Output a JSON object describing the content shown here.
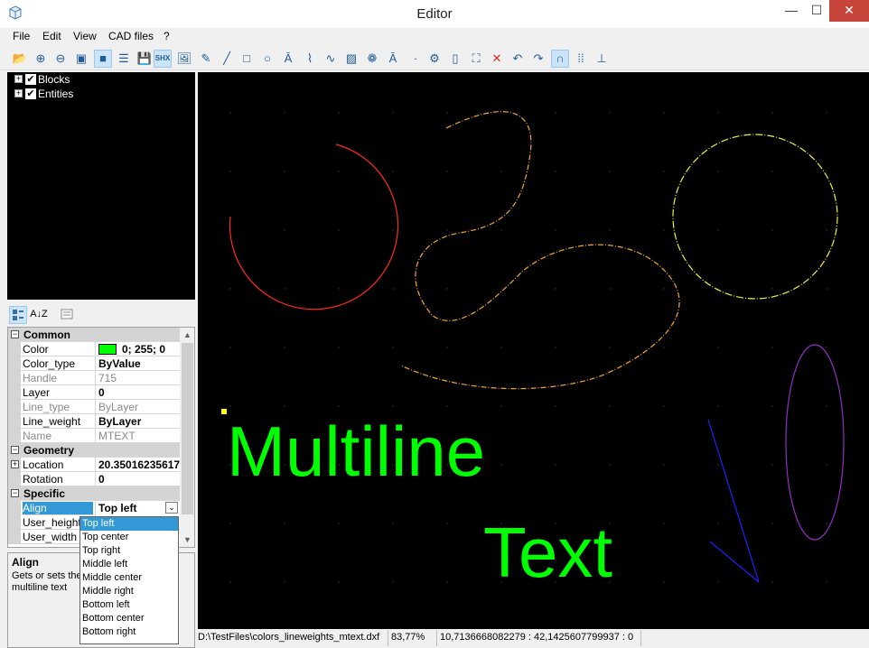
{
  "window": {
    "title": "Editor",
    "minimize": "—",
    "maximize": "☐",
    "close": "✕"
  },
  "menu": [
    {
      "label": "File"
    },
    {
      "label": "Edit"
    },
    {
      "label": "View"
    },
    {
      "label": "CAD files"
    },
    {
      "label": "?"
    }
  ],
  "toolbar": {
    "buttons": [
      {
        "icon": "open-folder-icon",
        "glyph": "📂"
      },
      {
        "icon": "zoom-in-icon",
        "glyph": "⊕"
      },
      {
        "icon": "zoom-out-icon",
        "glyph": "⊖"
      },
      {
        "icon": "zoom-fit-icon",
        "glyph": "▣"
      },
      {
        "icon": "black-background-icon",
        "glyph": "■",
        "active": true
      },
      {
        "icon": "layers-icon",
        "glyph": "☰"
      },
      {
        "icon": "save-icon",
        "glyph": "💾"
      },
      {
        "icon": "shx-fonts-icon",
        "label": "SHX",
        "active": true
      },
      {
        "icon": "image-icon",
        "glyph": "🖼"
      },
      {
        "icon": "pencil-icon",
        "glyph": "✎"
      },
      {
        "icon": "line-icon",
        "glyph": "╱"
      },
      {
        "icon": "rectangle-icon",
        "glyph": "□"
      },
      {
        "icon": "circle-icon",
        "glyph": "○"
      },
      {
        "icon": "text-icon",
        "glyph": "Ā"
      },
      {
        "icon": "polyline-icon",
        "glyph": "⌇"
      },
      {
        "icon": "spline-icon",
        "glyph": "∿"
      },
      {
        "icon": "hatch-icon",
        "glyph": "▨"
      },
      {
        "icon": "block-icon",
        "glyph": "❁"
      },
      {
        "icon": "mtext-icon",
        "glyph": "Ā"
      },
      {
        "icon": "point-icon",
        "glyph": "·"
      },
      {
        "icon": "properties-icon",
        "glyph": "⚙"
      },
      {
        "icon": "new-page-icon",
        "glyph": "▯"
      },
      {
        "icon": "select-all-icon",
        "glyph": "⛶"
      },
      {
        "icon": "delete-icon",
        "glyph": "✕",
        "color": "#d9261c"
      },
      {
        "icon": "undo-icon",
        "glyph": "↶"
      },
      {
        "icon": "redo-icon",
        "glyph": "↷"
      },
      {
        "icon": "snap-magnet-icon",
        "glyph": "∩",
        "active": true
      },
      {
        "icon": "grid-icon",
        "glyph": "⁞⁞"
      },
      {
        "icon": "ortho-icon",
        "glyph": "⊥"
      }
    ]
  },
  "tree": {
    "items": [
      {
        "label": "Blocks",
        "checked": true,
        "expander": "+",
        "check": "✔"
      },
      {
        "label": "Entities",
        "checked": true,
        "expander": "+",
        "check": "✔"
      }
    ]
  },
  "properties": {
    "toolbar": {
      "categorized_icon": "categorized-icon",
      "alphabetical_icon": "alphabetical-sort-icon",
      "alpha_label": "A↓Z",
      "pages_icon": "property-pages-icon"
    },
    "rows": [
      {
        "type": "category",
        "label": "Common",
        "expander": "−"
      },
      {
        "type": "prop",
        "name": "Color",
        "value": "0; 255; 0",
        "swatch": "#00ff00"
      },
      {
        "type": "prop",
        "name": "Color_type",
        "value": "ByValue"
      },
      {
        "type": "prop",
        "name": "Handle",
        "value": "715",
        "readonly": true
      },
      {
        "type": "prop",
        "name": "Layer",
        "value": "0"
      },
      {
        "type": "prop",
        "name": "Line_type",
        "value": "ByLayer",
        "readonly": true
      },
      {
        "type": "prop",
        "name": "Line_weight",
        "value": "ByLayer"
      },
      {
        "type": "prop",
        "name": "Name",
        "value": "MTEXT",
        "readonly": true
      },
      {
        "type": "category",
        "label": "Geometry",
        "expander": "−"
      },
      {
        "type": "prop",
        "name": "Location",
        "value": "20.35016235617",
        "expander": "+"
      },
      {
        "type": "prop",
        "name": "Rotation",
        "value": "0"
      },
      {
        "type": "category",
        "label": "Specific",
        "expander": "−"
      },
      {
        "type": "prop",
        "name": "Align",
        "value": "Top left",
        "selected": true,
        "dropdown": true
      },
      {
        "type": "prop",
        "name": "User_height",
        "value": ""
      },
      {
        "type": "prop",
        "name": "User_width",
        "value": ""
      }
    ],
    "dropdown_arrow": "⌄",
    "scroll_up": "▲",
    "scroll_down": "▼"
  },
  "description": {
    "title": "Align",
    "text": "Gets or sets the alignment of the multiline text"
  },
  "align_options": [
    "Top left",
    "Top center",
    "Top right",
    "Middle left",
    "Middle center",
    "Middle right",
    "Bottom left",
    "Bottom center",
    "Bottom right"
  ],
  "align_selected": "Top left",
  "drawing": {
    "mtext_line1": "Multiline",
    "mtext_line2": "Text",
    "colors": {
      "background": "#000000",
      "text": "#00ff00",
      "red_arc": "#ff2a1f",
      "orange_curve": "#f0a830",
      "yellow_circle": "#f0f040",
      "blue_line": "#2020ff",
      "purple_ellipse": "#9030c0",
      "grip": "#ffff00"
    }
  },
  "status": {
    "file_path": "D:\\TestFiles\\colors_lineweights_mtext.dxf",
    "zoom": "83,77%",
    "coordinates": "10,7136668082279 : 42,1425607799937 : 0"
  }
}
